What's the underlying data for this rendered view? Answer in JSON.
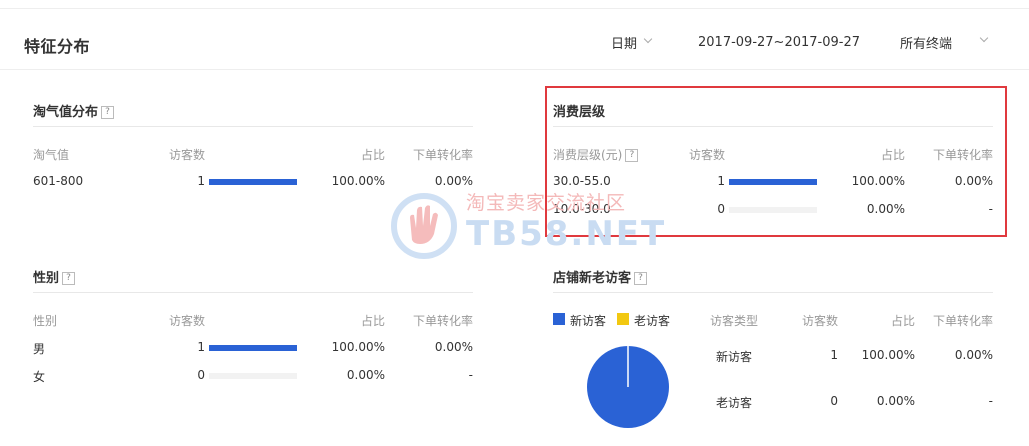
{
  "header": {
    "title": "特征分布",
    "date_label": "日期",
    "date_range": "2017-09-27~2017-09-27",
    "terminal": "所有终端"
  },
  "taoqi": {
    "title": "淘气值分布",
    "help": "?",
    "columns": [
      "淘气值",
      "访客数",
      "占比",
      "下单转化率"
    ],
    "rows": [
      {
        "label": "601-800",
        "visitors": "1",
        "share": "100.00%",
        "ratio": 1.0,
        "conversion": "0.00%"
      }
    ]
  },
  "consume": {
    "title": "消费层级",
    "columns": [
      "消费层级(元)",
      "访客数",
      "占比",
      "下单转化率"
    ],
    "help": "?",
    "rows": [
      {
        "label": "30.0-55.0",
        "visitors": "1",
        "share": "100.00%",
        "ratio": 1.0,
        "conversion": "0.00%"
      },
      {
        "label": "10.0-30.0",
        "visitors": "0",
        "share": "0.00%",
        "ratio": 0.0,
        "conversion": "-"
      }
    ]
  },
  "gender": {
    "title": "性别",
    "help": "?",
    "columns": [
      "性别",
      "访客数",
      "占比",
      "下单转化率"
    ],
    "rows": [
      {
        "label": "男",
        "visitors": "1",
        "share": "100.00%",
        "ratio": 1.0,
        "conversion": "0.00%"
      },
      {
        "label": "女",
        "visitors": "0",
        "share": "0.00%",
        "ratio": 0.0,
        "conversion": "-"
      }
    ]
  },
  "newold": {
    "title": "店铺新老访客",
    "help": "?",
    "legend": [
      {
        "name": "新访客",
        "color": "#2a62d5"
      },
      {
        "name": "老访客",
        "color": "#f2c811"
      }
    ],
    "columns": [
      "访客类型",
      "访客数",
      "占比",
      "下单转化率"
    ],
    "rows": [
      {
        "label": "新访客",
        "visitors": "1",
        "share": "100.00%",
        "conversion": "0.00%"
      },
      {
        "label": "老访客",
        "visitors": "0",
        "share": "0.00%",
        "conversion": "-"
      }
    ]
  },
  "chart_data": {
    "type": "pie",
    "categories": [
      "新访客",
      "老访客"
    ],
    "values": [
      1,
      0
    ],
    "colors": [
      "#2a62d5",
      "#f2c811"
    ]
  },
  "watermark": {
    "line1": "淘宝卖家交流社区",
    "line2": "TB58.NET"
  },
  "colors": {
    "accent": "#2a62d5",
    "highlight": "#e0393e",
    "old_visitor": "#f2c811"
  }
}
